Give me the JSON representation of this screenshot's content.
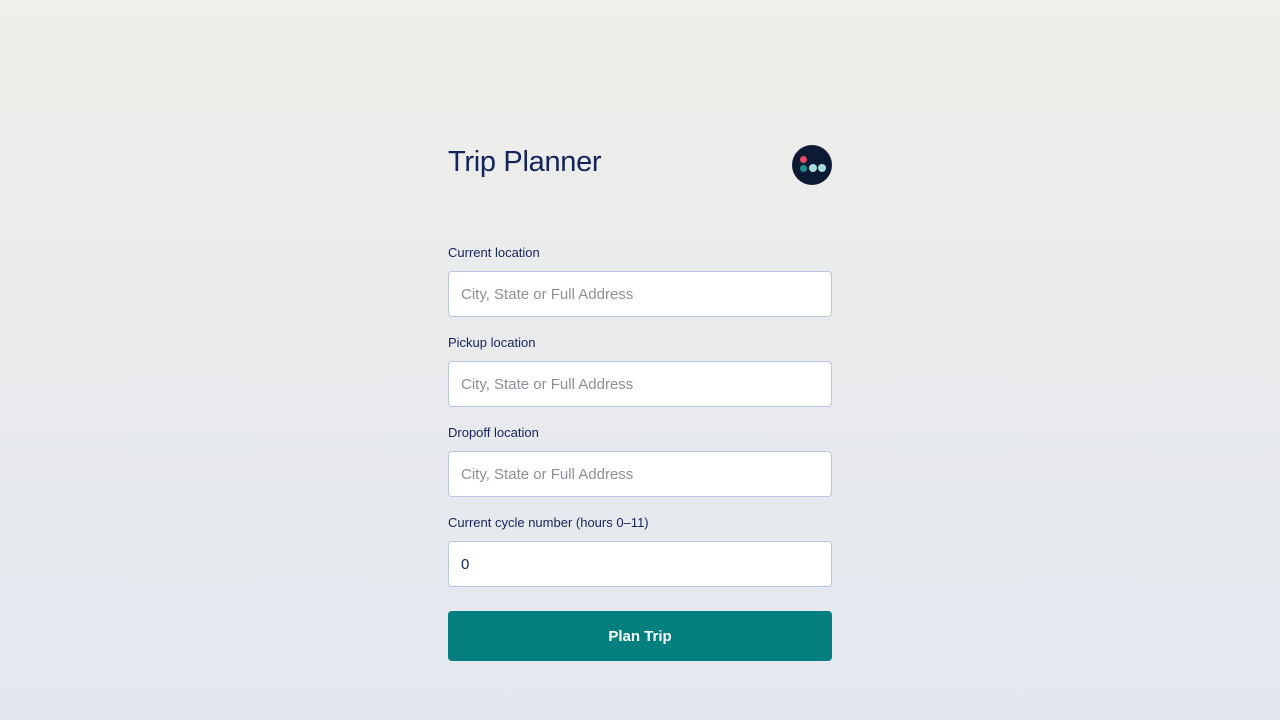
{
  "header": {
    "title": "Trip Planner",
    "logo_icon": "dots-logo-icon"
  },
  "form": {
    "current_location": {
      "label": "Current location",
      "placeholder": "City, State or Full Address",
      "value": ""
    },
    "pickup_location": {
      "label": "Pickup location",
      "placeholder": "City, State or Full Address",
      "value": ""
    },
    "dropoff_location": {
      "label": "Dropoff location",
      "placeholder": "City, State or Full Address",
      "value": ""
    },
    "cycle_number": {
      "label": "Current cycle number (hours 0–11)",
      "value": "0"
    },
    "submit_label": "Plan Trip"
  },
  "colors": {
    "accent": "#037f80",
    "text": "#13245a",
    "logo_bg": "#0c1a33",
    "logo_red": "#ea4a6a",
    "logo_teal": "#1f8f8c",
    "logo_light": "#a9dcdc"
  }
}
